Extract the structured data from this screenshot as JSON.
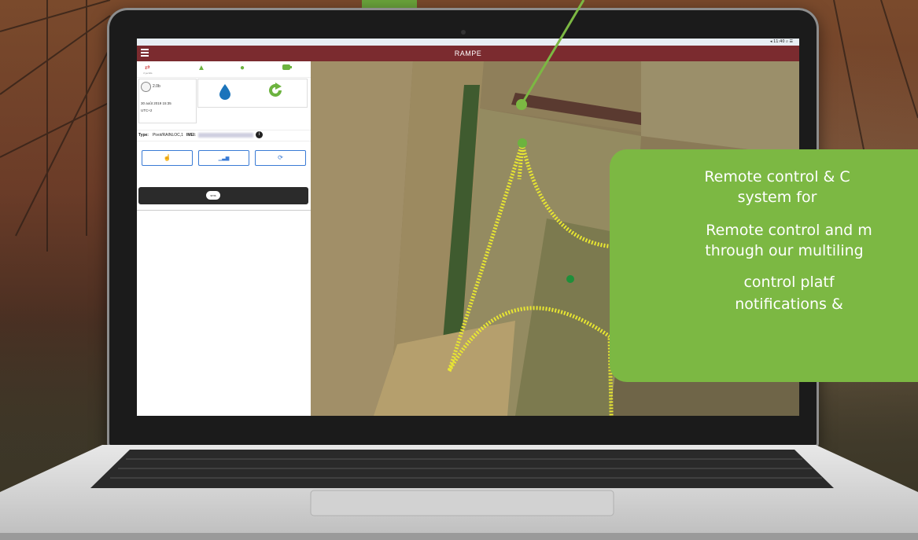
{
  "app": {
    "title": "RAMPE",
    "status_bar": "◂ 11:40 ⌕ ☰"
  },
  "sidebar": {
    "status_small": "il ya 32s",
    "pressure": "2.0b",
    "date": "30 août 2019 15:35",
    "timezone": "UTC+2",
    "type_label": "Type:",
    "type_value": "Pivot/RAINLOC,1",
    "imei_label": "IMEI:",
    "sms_label": "sms"
  },
  "overlay": {
    "line1": "Remote control & C",
    "line2": "system for",
    "line3": "Remote control and m",
    "line4": "through our multiling",
    "line5": "control platf",
    "line6": "notifications &"
  },
  "colors": {
    "header": "#7b2b2f",
    "accent_green": "#7cb843",
    "track_yellow": "#e8e632",
    "button_blue": "#3a7bd5"
  },
  "icons": [
    "menu-icon",
    "warning-icon",
    "chat-icon",
    "battery-icon",
    "signal-icon",
    "gauge-icon",
    "water-drop-icon",
    "refresh-icon",
    "hand-pointer-icon",
    "bar-chart-icon",
    "info-icon",
    "sms-icon"
  ]
}
